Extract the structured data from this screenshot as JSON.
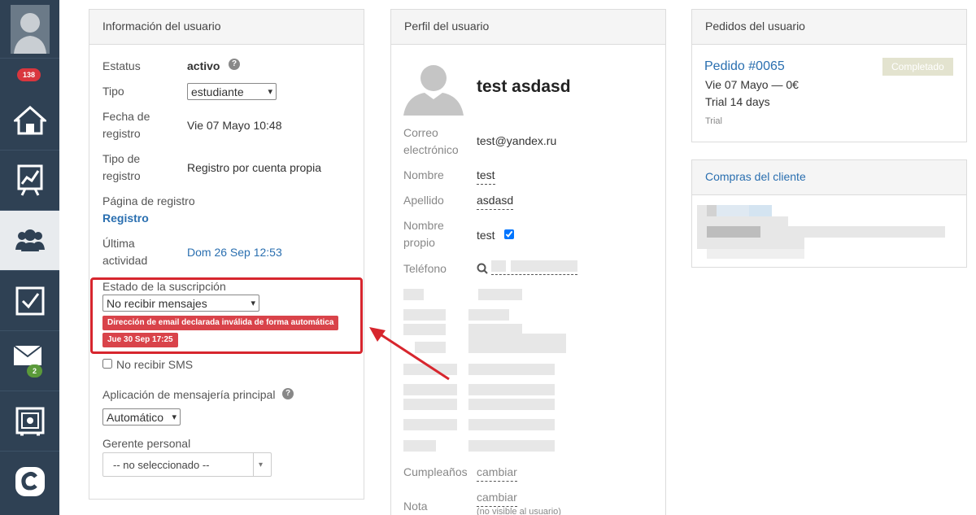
{
  "sidebar": {
    "badges": {
      "notifications": "138",
      "messages": "2"
    },
    "items": [
      "avatar-icon",
      "home-icon",
      "chart-icon",
      "users-icon",
      "tasks-icon",
      "mail-icon",
      "settings-box-icon",
      "brand-logo-icon"
    ]
  },
  "user_info": {
    "title": "Información del usuario",
    "status_label": "Estatus",
    "status_value": "activo",
    "type_label": "Tipo",
    "type_value": "estudiante",
    "reg_date_label_1": "Fecha de",
    "reg_date_label_2": "registro",
    "reg_date_value": "Vie 07 Mayo 10:48",
    "reg_type_label_1": "Tipo de",
    "reg_type_label_2": "registro",
    "reg_type_value": "Registro por cuenta propia",
    "reg_page_label": "Página de registro",
    "reg_page_value": "Registro",
    "last_activity_label_1": "Última",
    "last_activity_label_2": "actividad",
    "last_activity_value": "Dom 26 Sep 12:53",
    "subscription_label": "Estado de la suscripción",
    "subscription_value": "No recibir mensajes",
    "invalid_email_tag": "Dirección de email declarada inválida de forma automática",
    "invalid_date_tag": "Jue 30 Sep 17:25",
    "no_sms_label": "No recibir SMS",
    "messenger_label": "Aplicación de mensajería principal",
    "messenger_value": "Automático",
    "manager_label": "Gerente personal",
    "manager_value": "-- no seleccionado --"
  },
  "profile": {
    "title": "Perfil del usuario",
    "name": "test asdasd",
    "email_label_1": "Correo",
    "email_label_2": "electrónico",
    "email_value": "test@yandex.ru",
    "first_name_label": "Nombre",
    "first_name_value": "test",
    "last_name_label": "Apellido",
    "last_name_value": "asdasd",
    "own_name_label_1": "Nombre",
    "own_name_label_2": "propio",
    "own_name_value": "test",
    "phone_label": "Teléfono",
    "birthday_label": "Cumpleaños",
    "birthday_action": "cambiar",
    "note_label": "Nota",
    "note_action": "cambiar",
    "note_hint": "(no visible al usuario)"
  },
  "orders": {
    "title": "Pedidos del usuario",
    "order_link": "Pedido #0065",
    "order_status": "Completado",
    "order_date": "Vie 07 Mayo — 0€",
    "order_item": "Trial 14 days",
    "order_tag": "Trial"
  },
  "purchases": {
    "title": "Compras del cliente"
  }
}
